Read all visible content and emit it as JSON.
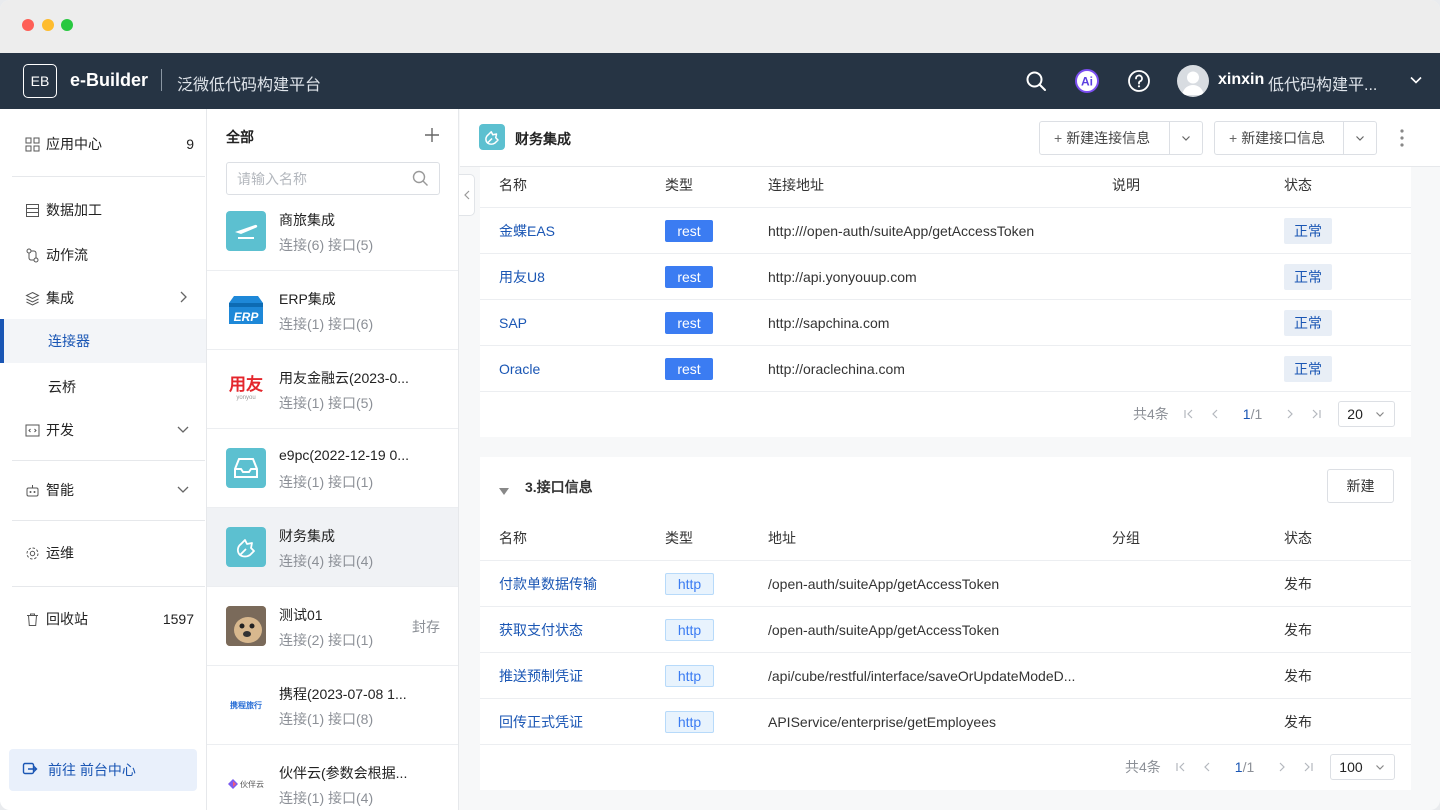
{
  "app": {
    "logo_text": "EB",
    "brand": "e-Builder",
    "subtitle": "泛微低代码构建平台",
    "user": "xinxin",
    "tenant": "低代码构建平..."
  },
  "nav": {
    "items": [
      {
        "label": "应用中心",
        "count": "9"
      },
      {
        "label": "数据加工"
      },
      {
        "label": "动作流"
      },
      {
        "label": "集成"
      },
      {
        "label": "连接器"
      },
      {
        "label": "云桥"
      },
      {
        "label": "开发"
      },
      {
        "label": "智能"
      },
      {
        "label": "运维"
      },
      {
        "label": "回收站",
        "count": "1597"
      }
    ],
    "goto_label": "前往 前台中心"
  },
  "list": {
    "title": "全部",
    "search_placeholder": "请输入名称",
    "items": [
      {
        "name": "商旅集成",
        "meta": "连接(6)  接口(5)"
      },
      {
        "name": "ERP集成",
        "meta": "连接(1)  接口(6)"
      },
      {
        "name": "用友金融云(2023-0...",
        "meta": "连接(1)  接口(5)"
      },
      {
        "name": "e9pc(2022-12-19 0...",
        "meta": "连接(1)  接口(1)"
      },
      {
        "name": "财务集成",
        "meta": "连接(4)  接口(4)"
      },
      {
        "name": "测试01",
        "meta": "连接(2)  接口(1)",
        "tag": "封存"
      },
      {
        "name": "携程(2023-07-08 1...",
        "meta": "连接(1)  接口(8)"
      },
      {
        "name": "伙伴云(参数会根据...",
        "meta": "连接(1)  接口(4)"
      }
    ],
    "logo_texts": {
      "erp": "ERP",
      "yonyou": "用友",
      "yonyou_sub": "yonyou",
      "ctrip": "携程旅行",
      "huoban": "伙伴云"
    }
  },
  "main": {
    "title": "财务集成",
    "btn_new_connection": "新建连接信息",
    "btn_new_interface": "新建接口信息",
    "connections": {
      "headers": [
        "名称",
        "类型",
        "连接地址",
        "说明",
        "状态"
      ],
      "rows": [
        {
          "name": "金蝶EAS",
          "type": "rest",
          "url": "http:///open-auth/suiteApp/getAccessToken",
          "desc": "",
          "status": "正常"
        },
        {
          "name": "用友U8",
          "type": "rest",
          "url": "http://api.yonyouup.com",
          "desc": "",
          "status": "正常"
        },
        {
          "name": "SAP",
          "type": "rest",
          "url": "http://sapchina.com",
          "desc": "",
          "status": "正常"
        },
        {
          "name": "Oracle",
          "type": "rest",
          "url": "http://oraclechina.com",
          "desc": "",
          "status": "正常"
        }
      ],
      "total": "共4条",
      "page": "1",
      "pages": "/1",
      "page_size": "20"
    },
    "interfaces": {
      "section_title": "3.接口信息",
      "new_label": "新建",
      "headers": [
        "名称",
        "类型",
        "地址",
        "分组",
        "状态"
      ],
      "rows": [
        {
          "name": "付款单数据传输",
          "type": "http",
          "url": "/open-auth/suiteApp/getAccessToken",
          "group": "",
          "status": "发布"
        },
        {
          "name": "获取支付状态",
          "type": "http",
          "url": "/open-auth/suiteApp/getAccessToken",
          "group": "",
          "status": "发布"
        },
        {
          "name": "推送预制凭证",
          "type": "http",
          "url": "/api/cube/restful/interface/saveOrUpdateModeD...",
          "group": "",
          "status": "发布"
        },
        {
          "name": "回传正式凭证",
          "type": "http",
          "url": "APIService/enterprise/getEmployees",
          "group": "",
          "status": "发布"
        }
      ],
      "total": "共4条",
      "page": "1",
      "pages": "/1",
      "page_size": "100"
    }
  },
  "colors": {
    "header_bg": "#263444",
    "accent": "#1a56b4",
    "rest_badge": "#3b7cf2",
    "teal_logo": "#5cc0d0"
  }
}
